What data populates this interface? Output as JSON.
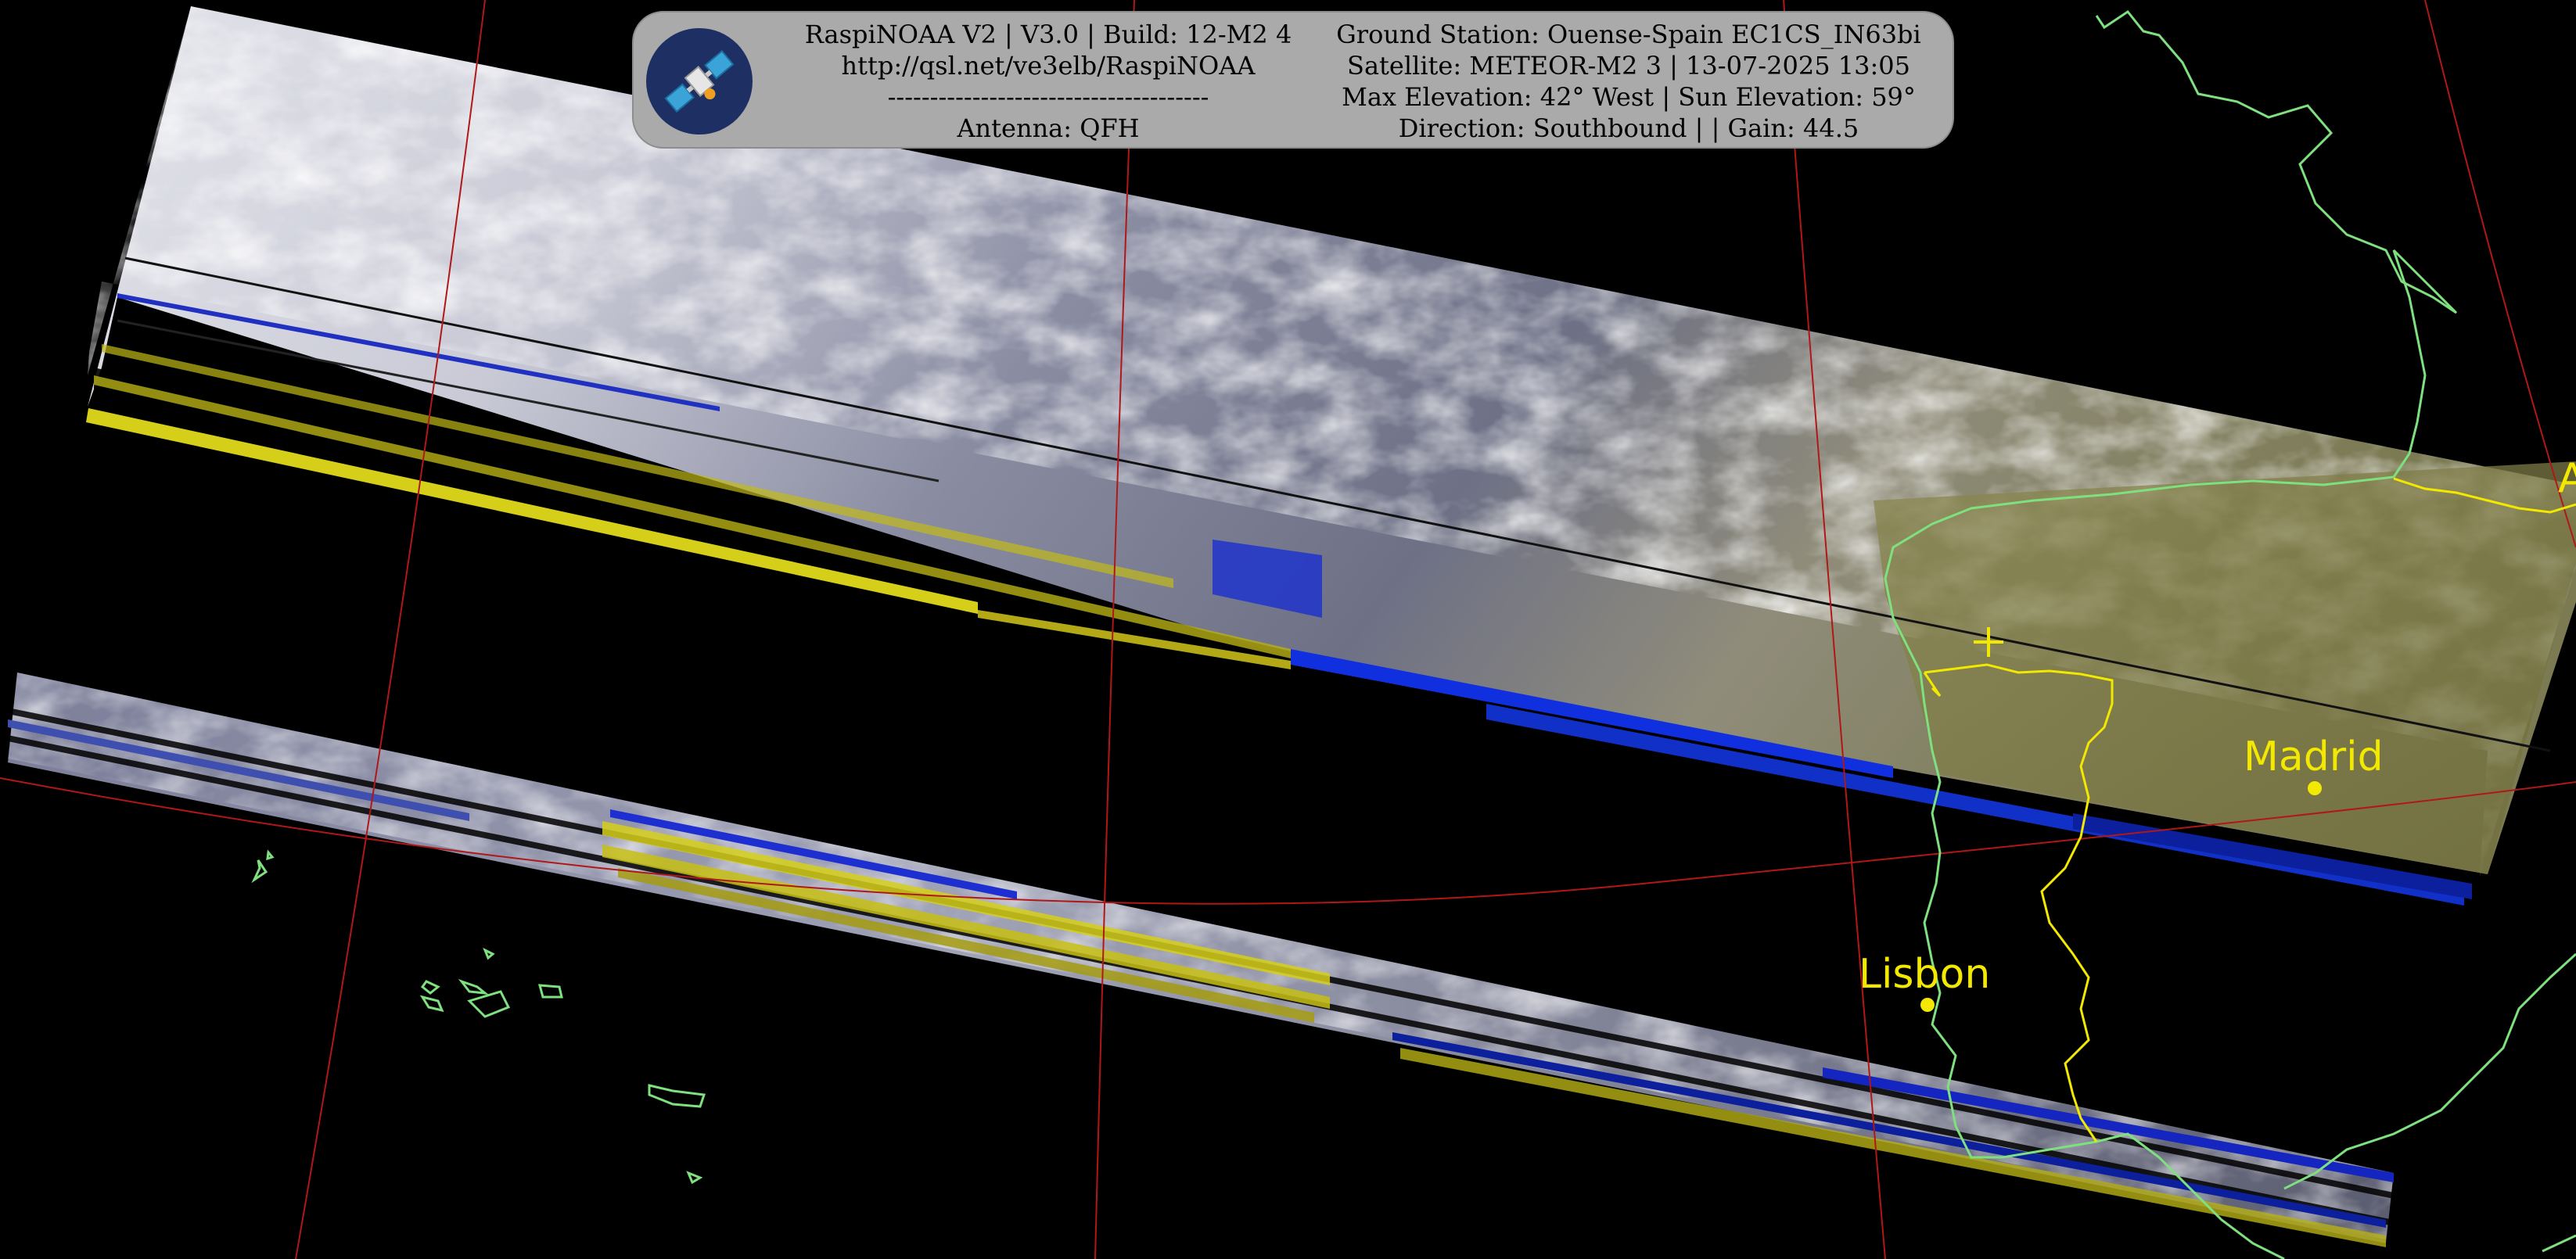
{
  "header": {
    "left_lines": [
      "RaspiNOAA V2 | V3.0 | Build: 12-M2 4",
      "http://qsl.net/ve3elb/RaspiNOAA",
      "--------------------------------------",
      "Antenna: QFH"
    ],
    "right_lines": [
      "Ground Station: Ouense-Spain EC1CS_IN63bi",
      "Satellite: METEOR-M2 3 | 13-07-2025 13:05",
      "Max Elevation: 42° West | Sun Elevation: 59°",
      "Direction: Southbound | | Gain: 44.5"
    ]
  },
  "logo": {
    "icon": "satellite-icon"
  },
  "map": {
    "cities": [
      {
        "name": "Madrid"
      },
      {
        "name": "Lisbon"
      }
    ],
    "edge_label": "A",
    "ground_station_marker": "plus-marker-icon"
  },
  "colors": {
    "background": "#000000",
    "coastline": "#7fe07f",
    "borders": "#f2e800",
    "graticule": "#b01818",
    "labels": "#f2e800",
    "info_box": "#aaaaaa"
  }
}
